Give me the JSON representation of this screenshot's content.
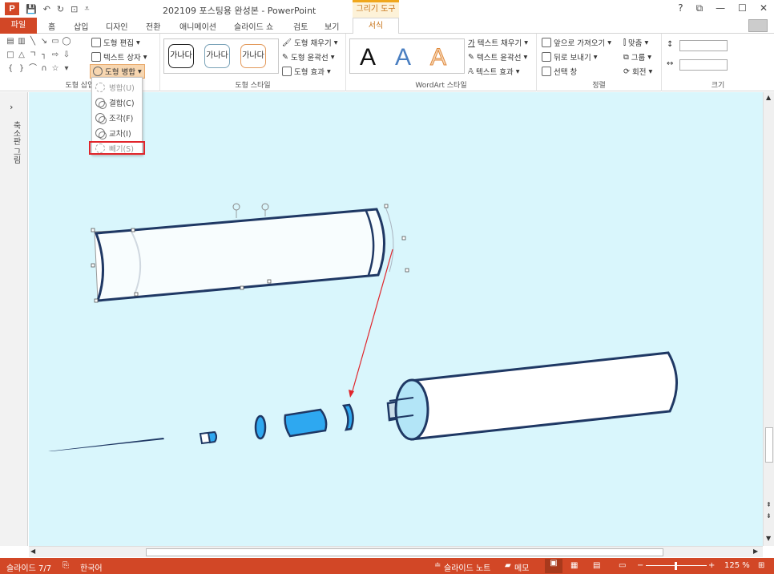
{
  "title": "202109 포스팅용 완성본 - PowerPoint",
  "contextual_tab_title": "그리기 도구",
  "window_buttons": [
    "?",
    "⧉",
    "—",
    "☐",
    "✕"
  ],
  "tabs": [
    "파일",
    "홈",
    "삽입",
    "디자인",
    "전환",
    "애니메이션",
    "슬라이드 쇼",
    "검토",
    "보기",
    "서식"
  ],
  "active_tab": "서식",
  "ribbon": {
    "insert_shapes_group": {
      "label": "도형 삽입",
      "edit_shape": "도형 편집",
      "text_box": "텍스트 상자",
      "merge_shapes": "도형 병합"
    },
    "shape_styles_group": {
      "label": "도형 스타일",
      "style_sample": "가나다",
      "fill": "도형 채우기",
      "outline": "도형 윤곽선",
      "effects": "도형 효과"
    },
    "wordart_group": {
      "label": "WordArt 스타일",
      "sample": "A",
      "text_fill": "텍스트 채우기",
      "text_outline": "텍스트 윤곽선",
      "text_effects": "텍스트 효과"
    },
    "arrange_group": {
      "label": "정렬",
      "bring_forward": "앞으로 가져오기",
      "send_backward": "뒤로 보내기",
      "selection_pane": "선택 창",
      "align": "맞춤",
      "group": "그룹",
      "rotate": "회전"
    },
    "size_group": {
      "label": "크기"
    }
  },
  "merge_menu": {
    "items": [
      {
        "label": "병합(U)",
        "enabled": false
      },
      {
        "label": "결합(C)",
        "enabled": true
      },
      {
        "label": "조각(F)",
        "enabled": true
      },
      {
        "label": "교차(I)",
        "enabled": true
      },
      {
        "label": "빼기(S)",
        "enabled": false
      }
    ],
    "highlighted_item": "빼기(S)"
  },
  "left_pane_label": "축소판 그림",
  "status": {
    "slide_info": "슬라이드 7/7",
    "language": "한국어",
    "notes": "슬라이드 노트",
    "comments": "메모",
    "zoom": "125 %"
  },
  "colors": {
    "accent": "#d24726",
    "canvas": "#d9f6fc",
    "shape_outline": "#1f3864",
    "highlight_box": "#e0252b",
    "blue_part": "#2ea8f0"
  }
}
